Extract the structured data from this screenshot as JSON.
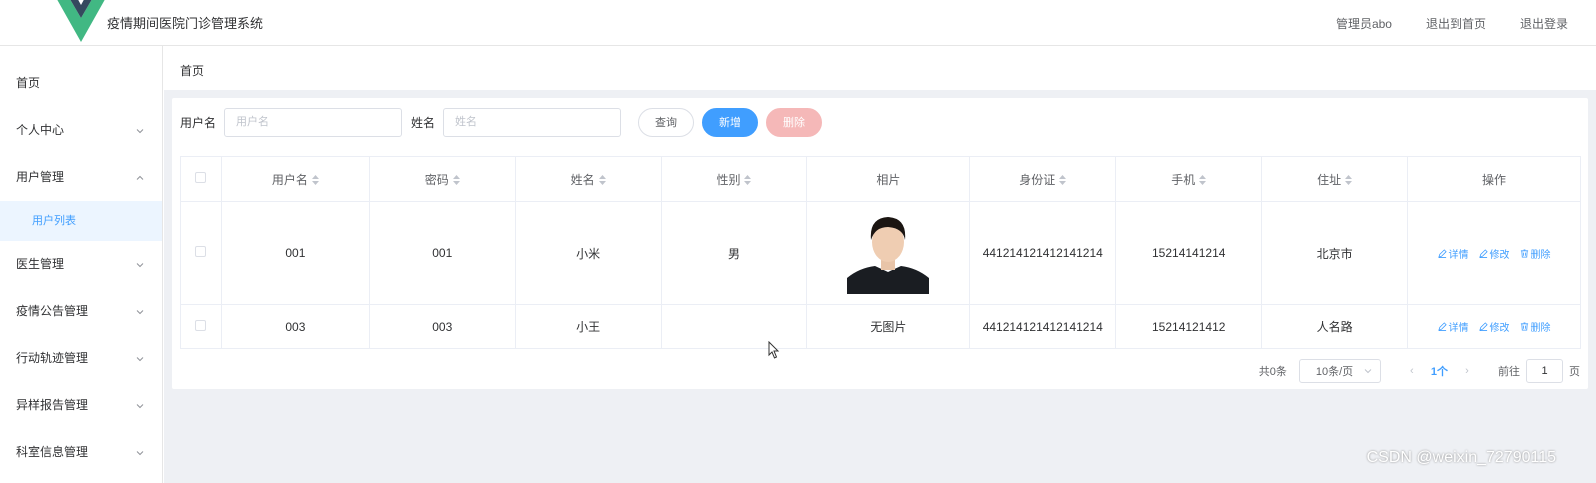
{
  "header": {
    "title": "疫情期间医院门诊管理系统",
    "links": [
      "管理员abo",
      "退出到首页",
      "退出登录"
    ],
    "logo_colors": {
      "outer": "#41b883",
      "inner": "#35495e"
    }
  },
  "sidebar": {
    "items": [
      {
        "label": "首页",
        "chevron": "none"
      },
      {
        "label": "个人中心",
        "chevron": "down"
      },
      {
        "label": "用户管理",
        "chevron": "up"
      },
      {
        "label": "医生管理",
        "chevron": "down"
      },
      {
        "label": "疫情公告管理",
        "chevron": "down"
      },
      {
        "label": "行动轨迹管理",
        "chevron": "down"
      },
      {
        "label": "异样报告管理",
        "chevron": "down"
      },
      {
        "label": "科室信息管理",
        "chevron": "down"
      }
    ],
    "active_sub_item": "用户列表"
  },
  "breadcrumb": "首页",
  "search": {
    "username_label": "用户名",
    "username_placeholder": "用户名",
    "name_label": "姓名",
    "name_placeholder": "姓名",
    "query_button": "查询",
    "add_button": "新增",
    "delete_button": "删除"
  },
  "table": {
    "columns": [
      "用户名",
      "密码",
      "姓名",
      "性别",
      "相片",
      "身份证",
      "手机",
      "住址",
      "操作"
    ],
    "rows": [
      {
        "username": "001",
        "password": "001",
        "name": "小米",
        "gender": "男",
        "photo": "image",
        "id_card": "441214121412141214",
        "phone": "15214141214",
        "address": "北京市"
      },
      {
        "username": "003",
        "password": "003",
        "name": "小王",
        "gender": "",
        "photo": "无图片",
        "id_card": "441214121412141214",
        "phone": "15214121412",
        "address": "人名路"
      }
    ],
    "actions": {
      "detail": "详情",
      "edit": "修改",
      "delete": "删除"
    }
  },
  "pagination": {
    "total": "共0条",
    "page_size": "10条/页",
    "current": "1个",
    "goto_label": "前往",
    "goto_value": "1",
    "page_suffix": "页"
  },
  "watermark": "CSDN @weixin_72790115",
  "colors": {
    "primary": "#409eff",
    "danger_light": "#f5b8b8",
    "main_bg": "#eef0f4"
  }
}
